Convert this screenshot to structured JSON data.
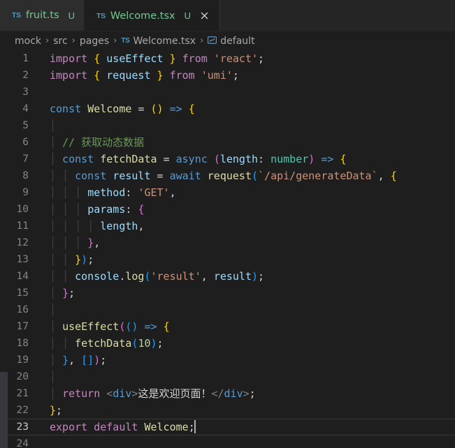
{
  "window": {
    "app": "Visual Studio Code",
    "theme": "Dark+ (default dark)",
    "colors": {
      "editor_background": "#1e1e1e",
      "tabbar_background": "#252526",
      "inactive_tab_background": "#2d2d2d",
      "active_tab_background": "#1e1e1e",
      "git_untracked": "#73c991",
      "line_number": "#858585",
      "active_line_number": "#c6c6c6",
      "indent_guide": "#404040",
      "scrollbar_thumb": "#37373d"
    }
  },
  "tabs": [
    {
      "icon": "typescript-file-icon",
      "icon_label": "TS",
      "label": "fruit.ts",
      "badge": "U",
      "active": false,
      "closable": false
    },
    {
      "icon": "typescript-react-file-icon",
      "icon_label": "TS",
      "label": "Welcome.tsx",
      "badge": "U",
      "active": true,
      "closable": true
    }
  ],
  "breadcrumbs": [
    {
      "label": "mock",
      "icon": null
    },
    {
      "label": "src",
      "icon": null
    },
    {
      "label": "pages",
      "icon": null
    },
    {
      "label": "Welcome.tsx",
      "icon": "typescript-react-file-icon",
      "icon_label": "TS"
    },
    {
      "label": "default",
      "icon": "symbol-variable-icon",
      "icon_glyph": "⬚"
    }
  ],
  "breadcrumb_separator": "›",
  "editor": {
    "language": "typescriptreact",
    "cursor_line": 23,
    "first_line": 1,
    "last_line": 24,
    "lines": [
      {
        "n": "1",
        "indent": 0
      },
      {
        "n": "2",
        "indent": 0
      },
      {
        "n": "3",
        "indent": 0
      },
      {
        "n": "4",
        "indent": 0
      },
      {
        "n": "5",
        "indent": 0
      },
      {
        "n": "6",
        "indent": 1
      },
      {
        "n": "7",
        "indent": 1
      },
      {
        "n": "8",
        "indent": 2
      },
      {
        "n": "9",
        "indent": 3
      },
      {
        "n": "10",
        "indent": 3
      },
      {
        "n": "11",
        "indent": 4
      },
      {
        "n": "12",
        "indent": 3
      },
      {
        "n": "13",
        "indent": 2
      },
      {
        "n": "14",
        "indent": 2
      },
      {
        "n": "15",
        "indent": 1
      },
      {
        "n": "16",
        "indent": 0
      },
      {
        "n": "17",
        "indent": 1
      },
      {
        "n": "18",
        "indent": 2
      },
      {
        "n": "19",
        "indent": 1
      },
      {
        "n": "20",
        "indent": 0
      },
      {
        "n": "21",
        "indent": 1
      },
      {
        "n": "22",
        "indent": 0
      },
      {
        "n": "23",
        "indent": 0
      },
      {
        "n": "24",
        "indent": 0
      }
    ],
    "source": [
      "import { useEffect } from 'react';",
      "import { request } from 'umi';",
      "",
      "const Welcome = () => {",
      "",
      "  // 获取动态数据",
      "  const fetchData = async (length: number) => {",
      "    const result = await request(`/api/generateData`, {",
      "      method: 'GET',",
      "      params: {",
      "        length,",
      "      },",
      "    });",
      "    console.log('result', result);",
      "  };",
      "",
      "  useEffect(() => {",
      "    fetchData(10);",
      "  }, []);",
      "",
      "  return <div>这是欢迎页面！</div>;",
      "};",
      "export default Welcome;",
      ""
    ]
  }
}
